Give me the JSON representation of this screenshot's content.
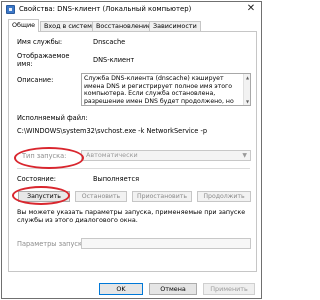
{
  "window": {
    "title": "Свойства: DNS-клиент (Локальный компьютер)",
    "close_symbol": "✕"
  },
  "tabs": [
    {
      "label": "Общие",
      "active": true
    },
    {
      "label": "Вход в систему",
      "active": false
    },
    {
      "label": "Восстановление",
      "active": false
    },
    {
      "label": "Зависимости",
      "active": false
    }
  ],
  "general": {
    "service_name_label": "Имя службы:",
    "service_name_value": "Dnscache",
    "display_name_label_1": "Отображаемое",
    "display_name_label_2": "имя:",
    "display_name_value": "DNS-клиент",
    "description_label": "Описание:",
    "description_text": "Служба DNS-клиента (dnscache) кэширует\nимена DNS и регистрирует полное имя этого\nкомпьютера. Если служба остановлена,\nразрешение имен DNS будет продолжено, но",
    "exec_label": "Исполняемый файл:",
    "exec_path": "C:\\WINDOWS\\system32\\svchost.exe -k NetworkService -p",
    "startup_type_label": "Тип запуска:",
    "startup_type_value": "Автоматически",
    "status_label": "Состояние:",
    "status_value": "Выполняется",
    "info_text": "Вы можете указать параметры запуска, применяемые при запуске службы из этого диалогового окна.",
    "params_label": "Параметры запуска:"
  },
  "service_buttons": {
    "start": "Запустить",
    "stop": "Остановить",
    "pause": "Приостановить",
    "resume": "Продолжить"
  },
  "footer": {
    "ok": "OK",
    "cancel": "Отмена",
    "apply": "Применить"
  },
  "colors": {
    "highlight": "#d9262e",
    "accent": "#0078d7"
  }
}
